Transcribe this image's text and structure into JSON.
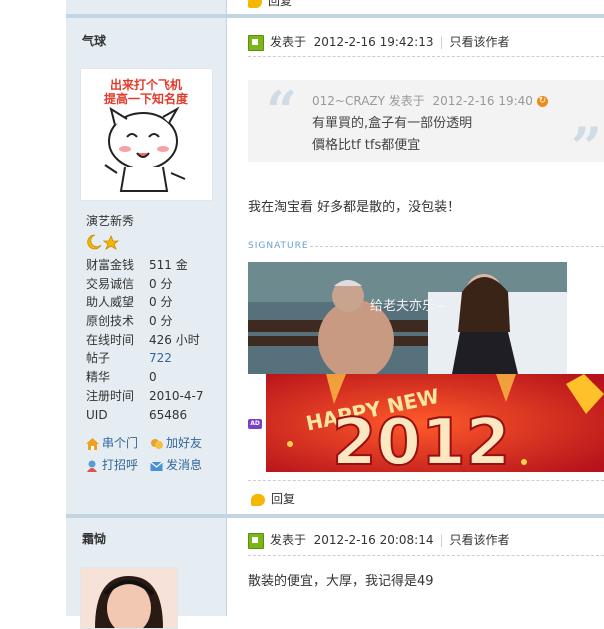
{
  "top_reply": {
    "label": "回复"
  },
  "post1": {
    "author": {
      "name": "气球",
      "avatar_text": [
        "出来打个飞机",
        "提高一下知名度"
      ],
      "rank": "演艺新秀",
      "profile": [
        {
          "key": "财富金钱",
          "value": "511 金"
        },
        {
          "key": "交易诚信",
          "value": "0 分"
        },
        {
          "key": "助人威望",
          "value": "0 分"
        },
        {
          "key": "原创技术",
          "value": "0 分"
        },
        {
          "key": "在线时间",
          "value": "426 小时"
        },
        {
          "key": "帖子",
          "value": "722"
        },
        {
          "key": "精华",
          "value": "0"
        },
        {
          "key": "注册时间",
          "value": "2010-4-7"
        },
        {
          "key": "UID",
          "value": "65486"
        }
      ],
      "actions": {
        "visit": "串个门",
        "add_friend": "加好友",
        "greet": "打招呼",
        "message": "发消息"
      }
    },
    "meta": {
      "posted_label": "发表于",
      "time": "2012-2-16 19:42:13",
      "only_author": "只看该作者"
    },
    "quote": {
      "author": "012~CRAZY",
      "posted_label": "发表于",
      "time": "2012-2-16 19:40",
      "lines": [
        "有單買的,盒子有一部份透明",
        "價格比tf tfs都便宜"
      ]
    },
    "body": "我在淘宝看 好多都是散的，没包装！",
    "signature_label": "SIGNATURE",
    "photo_caption": "给老夫亦乐~",
    "banner_text": {
      "happy": "HAPPY NEW",
      "year": "2012"
    },
    "ad_label": "AD",
    "reply_label": "回复"
  },
  "post2": {
    "author": {
      "name": "霜恸"
    },
    "meta": {
      "posted_label": "发表于",
      "time": "2012-2-16 20:08:14",
      "only_author": "只看该作者"
    },
    "body": "散装的便宜，大厚，我记得是49"
  }
}
